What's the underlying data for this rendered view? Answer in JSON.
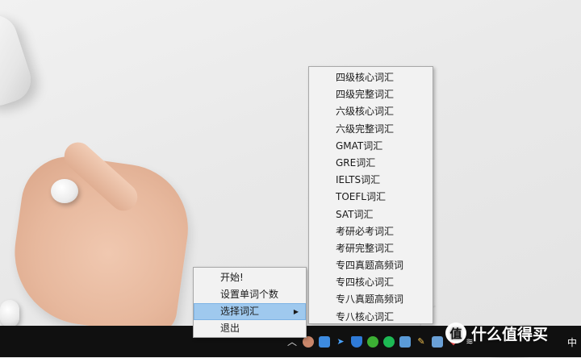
{
  "context_menu": {
    "items": [
      {
        "label": "开始!"
      },
      {
        "label": "设置单词个数"
      },
      {
        "label": "选择词汇",
        "has_submenu": true,
        "active": true
      },
      {
        "label": "退出"
      }
    ]
  },
  "vocab_submenu": {
    "items": [
      "四级核心词汇",
      "四级完整词汇",
      "六级核心词汇",
      "六级完整词汇",
      "GMAT词汇",
      "GRE词汇",
      "IELTS词汇",
      "TOEFL词汇",
      "SAT词汇",
      "考研必考词汇",
      "考研完整词汇",
      "专四真题高频词",
      "专四核心词汇",
      "专八真题高频词",
      "专八核心词汇"
    ]
  },
  "taskbar": {
    "tray_icons": [
      "show-hidden-icons-icon",
      "user-avatar-icon",
      "app-window-icon",
      "send-icon",
      "shield-icon",
      "wechat-icon",
      "spotify-icon",
      "grid-icon",
      "pen-icon",
      "image-icon",
      "red-app-icon",
      "network-icon"
    ],
    "input_method": "中"
  },
  "watermark": {
    "logo": "值",
    "text": "什么值得买"
  },
  "colors": {
    "menu_background": "#f2f2f2",
    "menu_highlight": "#9fc9ee",
    "taskbar": "#101010"
  }
}
